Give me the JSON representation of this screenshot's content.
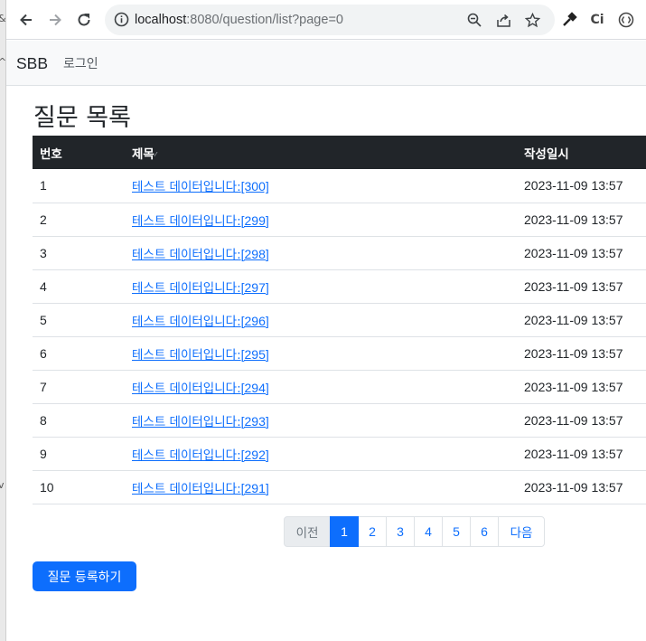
{
  "browser": {
    "url_host": "localhost",
    "url_path": ":8080/question/list?page=0"
  },
  "navbar": {
    "brand": "SBB",
    "login": "로그인"
  },
  "page": {
    "title": "질문 목록"
  },
  "table": {
    "headers": {
      "number": "번호",
      "subject": "제목",
      "date": "작성일시"
    },
    "rows": [
      {
        "number": "1",
        "title": "테스트 데이터입니다:",
        "tag": "[300]",
        "date": "2023-11-09 13:57"
      },
      {
        "number": "2",
        "title": "테스트 데이터입니다:",
        "tag": "[299]",
        "date": "2023-11-09 13:57"
      },
      {
        "number": "3",
        "title": "테스트 데이터입니다:",
        "tag": "[298]",
        "date": "2023-11-09 13:57"
      },
      {
        "number": "4",
        "title": "테스트 데이터입니다:",
        "tag": "[297]",
        "date": "2023-11-09 13:57"
      },
      {
        "number": "5",
        "title": "테스트 데이터입니다:",
        "tag": "[296]",
        "date": "2023-11-09 13:57"
      },
      {
        "number": "6",
        "title": "테스트 데이터입니다:",
        "tag": "[295]",
        "date": "2023-11-09 13:57"
      },
      {
        "number": "7",
        "title": "테스트 데이터입니다:",
        "tag": "[294]",
        "date": "2023-11-09 13:57"
      },
      {
        "number": "8",
        "title": "테스트 데이터입니다:",
        "tag": "[293]",
        "date": "2023-11-09 13:57"
      },
      {
        "number": "9",
        "title": "테스트 데이터입니다:",
        "tag": "[292]",
        "date": "2023-11-09 13:57"
      },
      {
        "number": "10",
        "title": "테스트 데이터입니다:",
        "tag": "[291]",
        "date": "2023-11-09 13:57"
      }
    ]
  },
  "pagination": {
    "prev": "이전",
    "pages": [
      "1",
      "2",
      "3",
      "4",
      "5",
      "6"
    ],
    "active_page": "1",
    "next": "다음"
  },
  "actions": {
    "register": "질문 등록하기"
  },
  "colors": {
    "primary": "#0d6efd",
    "table_header_bg": "#212529",
    "navbar_bg": "#f8f9fa"
  }
}
